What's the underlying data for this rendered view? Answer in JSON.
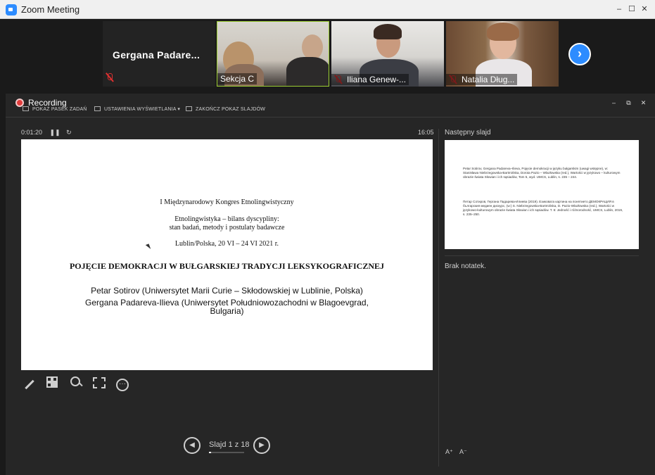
{
  "window": {
    "title": "Zoom Meeting",
    "controls": [
      "–",
      "☐",
      "✕"
    ]
  },
  "gallery": {
    "name_only_tile": "Gergana  Padare...",
    "tiles": [
      {
        "label": "Sekcja C",
        "muted": false
      },
      {
        "label": "Iliana Genew-...",
        "muted": true
      },
      {
        "label": "Natalia Dług...",
        "muted": true
      }
    ],
    "next_arrow": "›"
  },
  "recording": {
    "title": "Recording",
    "toolbar": {
      "taskbar": "POKAŻ PASEK ZADAŃ",
      "display": "USTAWIENIA WYŚWIETLANIA ▾",
      "end": "ZAKOŃCZ POKAZ SLAJDÓW"
    },
    "controls": [
      "–",
      "⧉",
      "✕"
    ],
    "elapsed": "0:01:20",
    "pause": "❚❚",
    "reset": "↻",
    "clock": "16:05"
  },
  "slide": {
    "line1": "I Międzynarodowy Kongres Etnolingwistyczny",
    "line2": "Etnolingwistyka – bilans dyscypliny:",
    "line3": "stan badań, metody i postulaty badawcze",
    "line4": "Lublin/Polska, 20 VI – 24 VI 2021 r.",
    "title": "POJĘCIE DEMOKRACJI W BUŁGARSKIEJ TRADYCJI LEKSYKOGRAFICZNEJ",
    "author1": "Petar Sotirov (Uniwersytet Marii Curie – Skłodowskiej  w Lublinie, Polska)",
    "author2": "Gergana Padareva-Ilieva (Uniwersytet Południowozachodni  w Blagoevgrad,",
    "author2b": "Bulgaria)"
  },
  "pager": {
    "prev": "◀",
    "label": "Slajd 1 z 18",
    "next": "▶",
    "progress": 0.0556
  },
  "side": {
    "next_label": "Następny slajd",
    "next_slide_text1": "Petar Sotirov, Gergana Padareva–Ilieva, Pojęcie demokracji w języku bułgarskim (uwagi wstępne), w: Stanisława Niebrzegowska-Bartmińska, Dorota Pazio – Wlazłowska (red.), Wartości w językowo – kulturowym obrazie świata Słowian i ich sąsiadów, Tom 5, wyd. UMCS, Lublin, s. 235 – 244.",
    "next_slide_text2": "Петар Сотиров, Гергана Падарева-Илиева (2019). Езиковата картина на понятието ДЕМОКРАЦИЯ в българския медиен дискурс, (w:) S. Niebrzegowska-Bartmińska, D. Pazio-Wlazłowska (red.), Wartości w językowo-kulturowym obrazie świata Słowian i ich sąsiadów. T. 6: Jedność i różnorodność, UMCS, Lublin, 2019, s. 235–250.",
    "notes": "Brak notatek.",
    "font_up": "A⁺",
    "font_down": "A⁻"
  }
}
